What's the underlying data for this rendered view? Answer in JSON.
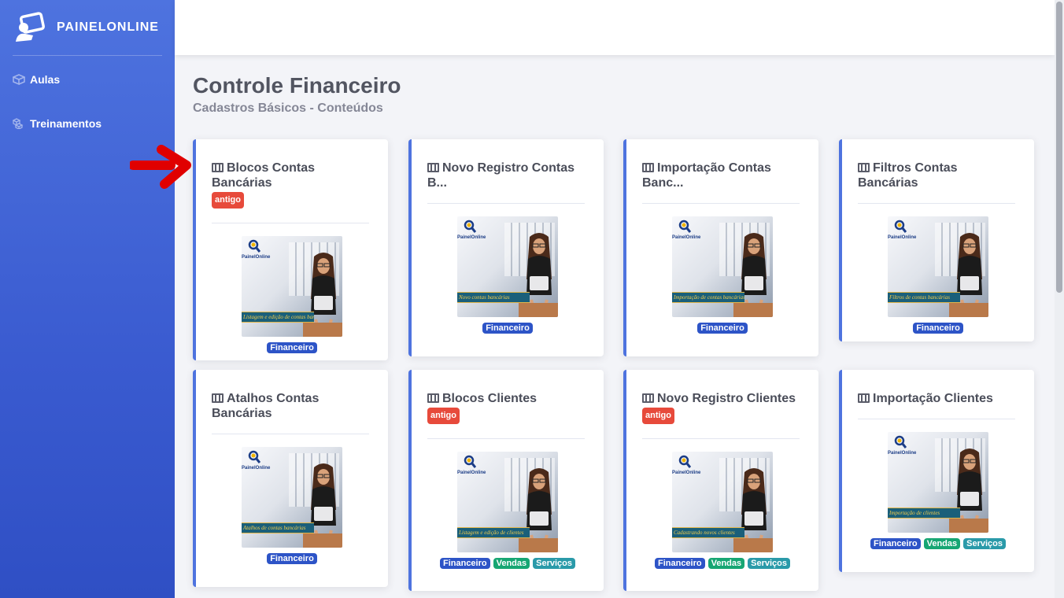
{
  "brand": {
    "name": "PAINELONLINE"
  },
  "sidebar": {
    "items": [
      {
        "label": "Aulas",
        "icon": "cube-icon"
      },
      {
        "label": "Treinamentos",
        "icon": "cubes-icon"
      }
    ]
  },
  "page": {
    "title": "Controle Financeiro",
    "subtitle": "Cadastros Básicos - Conteúdos"
  },
  "thumb_brand": "PainelOnline",
  "cards": [
    {
      "title": "Blocos Contas Bancárias",
      "badge": "antigo",
      "banner": "Listagem e edição de contas bancárias",
      "tags": [
        "Financeiro"
      ]
    },
    {
      "title": "Novo Registro Contas B...",
      "badge": "",
      "banner": "Novo contas bancárias",
      "tags": [
        "Financeiro"
      ]
    },
    {
      "title": "Importação Contas Banc...",
      "badge": "",
      "banner": "Importação de contas bancárias",
      "tags": [
        "Financeiro"
      ]
    },
    {
      "title": "Filtros Contas Bancárias",
      "badge": "",
      "banner": "Filtros de contas bancárias",
      "tags": [
        "Financeiro"
      ]
    },
    {
      "title": "Atalhos Contas Bancárias",
      "badge": "",
      "banner": "Atalhos de contas bancárias",
      "tags": [
        "Financeiro"
      ]
    },
    {
      "title": "Blocos Clientes",
      "badge": "antigo",
      "banner": "Listagem e edição de clientes",
      "tags": [
        "Financeiro",
        "Vendas",
        "Serviços"
      ]
    },
    {
      "title": "Novo Registro Clientes",
      "badge": "antigo",
      "banner": "Cadastrando novos clientes",
      "tags": [
        "Financeiro",
        "Vendas",
        "Serviços"
      ]
    },
    {
      "title": "Importação Clientes",
      "badge": "",
      "banner": "Importação de clientes",
      "tags": [
        "Financeiro",
        "Vendas",
        "Serviços"
      ]
    }
  ],
  "colors": {
    "sidebar": "#4e73df",
    "badge_old": "#e74a3b",
    "tag_financeiro": "#2d54c7",
    "tag_vendas": "#17a673",
    "tag_servicos": "#2a9aa9",
    "arrow": "#e00000"
  }
}
